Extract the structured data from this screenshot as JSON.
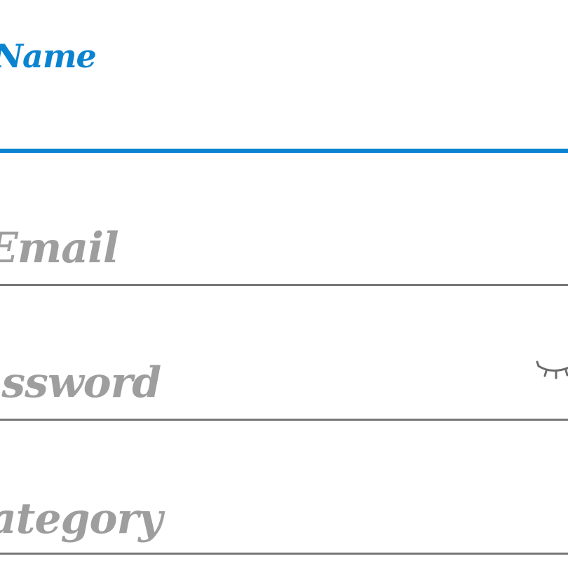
{
  "form": {
    "fields": [
      {
        "key": "name",
        "label": "Name",
        "state": "focused",
        "value": ""
      },
      {
        "key": "email",
        "label": "Email",
        "state": "idle",
        "value": ""
      },
      {
        "key": "password",
        "label": "Password",
        "state": "idle",
        "value": "",
        "visibility_icon": "eye-closed-icon"
      },
      {
        "key": "category",
        "label": "Category",
        "state": "idle",
        "value": ""
      }
    ]
  },
  "colors": {
    "accent": "#0a84d0",
    "placeholder": "#9e9e9e",
    "underline": "#777777",
    "background": "#ffffff"
  }
}
